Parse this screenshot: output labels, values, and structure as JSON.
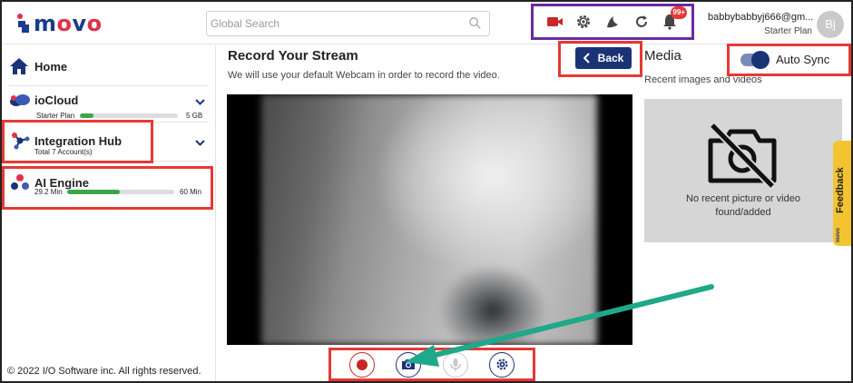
{
  "header": {
    "logo_text_left": "m",
    "logo_text_o": "o",
    "logo_text_right": "v",
    "logo_text_end": "o",
    "search_placeholder": "Global Search",
    "toolbar_icons": [
      "video-camera-icon",
      "gear-icon",
      "theme-icon",
      "refresh-icon",
      "bell-icon"
    ],
    "notification_badge": "99+",
    "user_email": "babbybabbyj666@gm...",
    "user_plan": "Starter Plan",
    "avatar_initials": "Bj"
  },
  "sidebar": {
    "home_label": "Home",
    "iocloud": {
      "label": "ioCloud",
      "plan": "Starter Plan",
      "storage": "5 GB",
      "usage_fraction": 0.14
    },
    "integration_hub": {
      "label": "Integration Hub",
      "sub": "Total 7 Account(s)"
    },
    "ai_engine": {
      "label": "AI Engine",
      "used": "29.2 Min",
      "total": "60 Min",
      "usage_fraction": 0.49
    },
    "footer": "© 2022 I/O Software inc. All rights reserved."
  },
  "main": {
    "title": "Record Your Stream",
    "subtitle": "We will use your default Webcam in order to record the video.",
    "back_label": "Back",
    "controls": [
      "record-icon",
      "camera-icon",
      "microphone-icon",
      "gear-icon"
    ]
  },
  "media": {
    "title": "Media",
    "subtitle": "Recent images and videos",
    "auto_sync_label": "Auto Sync",
    "auto_sync_on": true,
    "empty_text": "No recent picture or video found/added",
    "feedback_label": "Feedback",
    "feedback_logo": "movo"
  },
  "colors": {
    "brand_navy": "#1a3377",
    "accent_red": "#e53935",
    "toolbar_border": "#6a2aa0",
    "annotation_arrow": "#1fa88a",
    "progress_green": "#3aa64a",
    "feedback_yellow": "#f4c430"
  }
}
